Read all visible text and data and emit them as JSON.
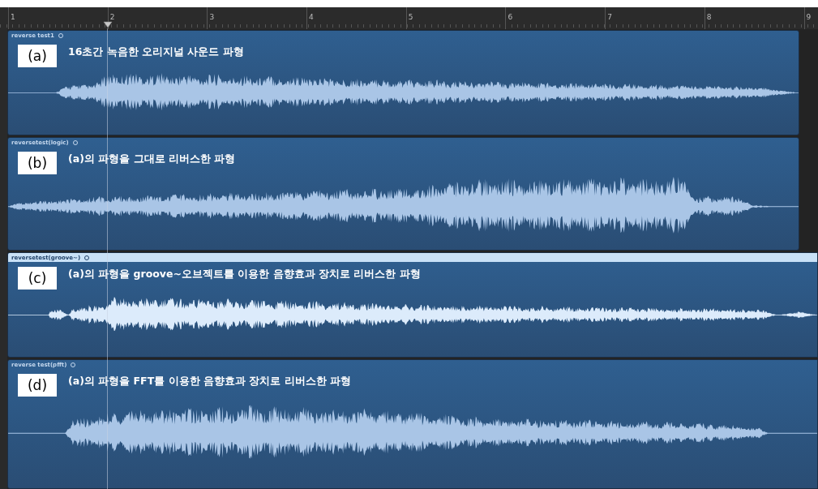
{
  "ruler": {
    "bars": [
      "1",
      "2",
      "3",
      "4",
      "5",
      "6",
      "7",
      "8",
      "9"
    ]
  },
  "regions": [
    {
      "name": "reverse test1",
      "label": "(a)",
      "caption": "16초간 녹음한 오리지널 사운드 파형",
      "selected": false,
      "runs_past_edge": false
    },
    {
      "name": "reversetest(logic)",
      "label": "(b)",
      "caption": "(a)의 파형을 그대로 리버스한 파형",
      "selected": false,
      "runs_past_edge": false
    },
    {
      "name": "reversetest(groove~)",
      "label": "(c)",
      "caption": "(a)의 파형을 groove~오브젝트를 이용한 음향효과 장치로 리버스한 파형",
      "selected": true,
      "runs_past_edge": true
    },
    {
      "name": "reverse test(pfft)",
      "label": "(d)",
      "caption": "(a)의 파형을 FFT를 이용한 음향효과 장치로 리버스한 파형",
      "selected": false,
      "runs_past_edge": true
    }
  ]
}
